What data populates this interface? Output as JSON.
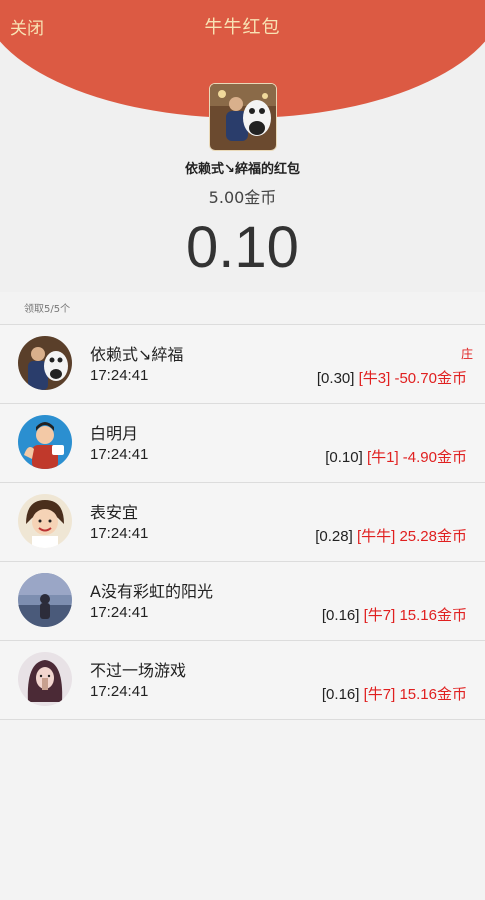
{
  "header": {
    "close_label": "关闭",
    "title": "牛牛红包"
  },
  "sender": {
    "name": "依赖式↘綷福的红包",
    "total": "5.00金币",
    "my_amount": "0.10"
  },
  "received_count": "领取5/5个",
  "colors": {
    "header_red": "#dc5a43",
    "header_text": "#f8e3b4",
    "result_red": "#e02020"
  },
  "list": [
    {
      "name": "依赖式↘綷福",
      "time": "17:24:41",
      "amount": "[0.30]",
      "niu": "[牛3]",
      "coins": "-50.70金币",
      "tag": "庄"
    },
    {
      "name": "白明月",
      "time": "17:24:41",
      "amount": "[0.10]",
      "niu": "[牛1]",
      "coins": "-4.90金币",
      "tag": ""
    },
    {
      "name": "表安宜",
      "time": "17:24:41",
      "amount": "[0.28]",
      "niu": "[牛牛]",
      "coins": "25.28金币",
      "tag": ""
    },
    {
      "name": "A没有彩虹的阳光",
      "time": "17:24:41",
      "amount": "[0.16]",
      "niu": "[牛7]",
      "coins": "15.16金币",
      "tag": ""
    },
    {
      "name": "不过一场游戏",
      "time": "17:24:41",
      "amount": "[0.16]",
      "niu": "[牛7]",
      "coins": "15.16金币",
      "tag": ""
    }
  ]
}
